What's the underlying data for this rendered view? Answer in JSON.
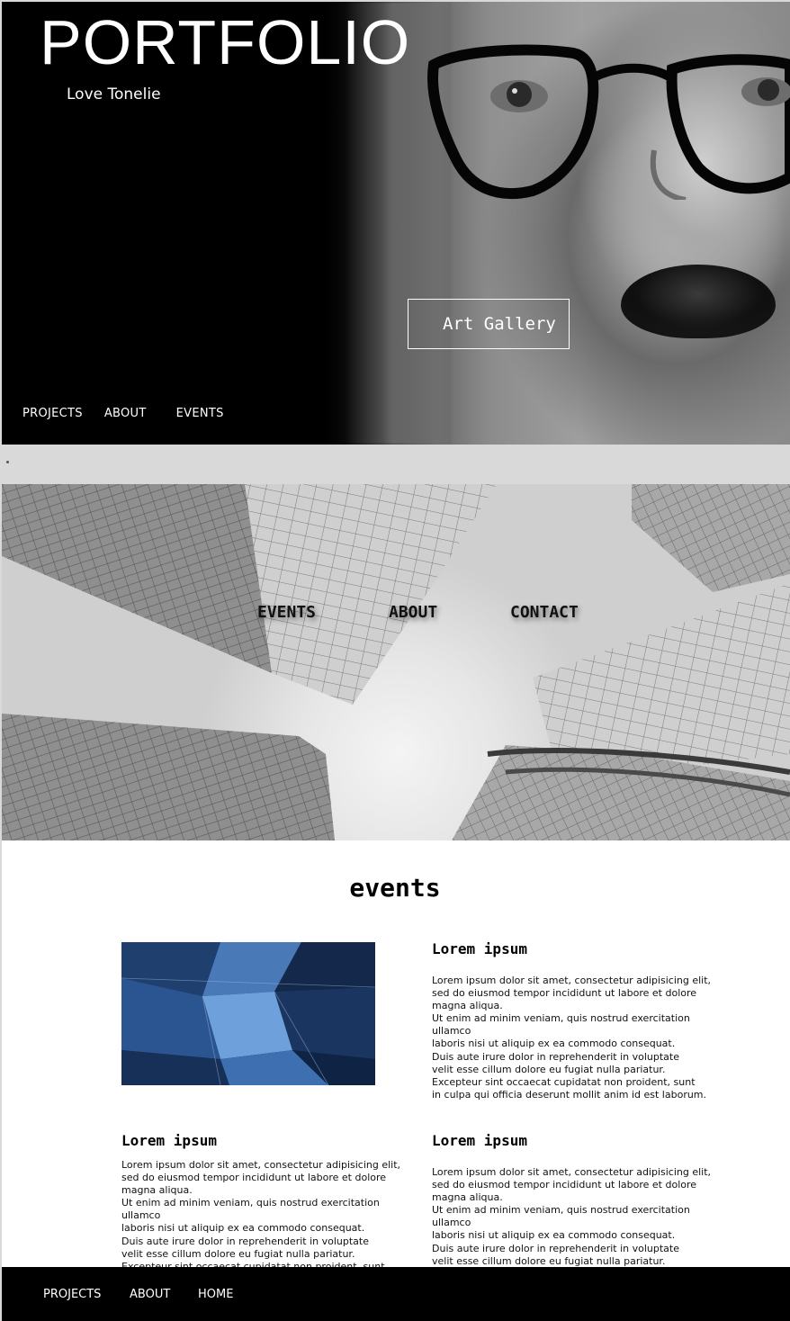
{
  "hero": {
    "title": "PORTFOLIO",
    "subtitle": "Love Tonelie",
    "cta_label": "Art Gallery",
    "nav": [
      "PROJECTS",
      "ABOUT",
      "EVENTS"
    ]
  },
  "city": {
    "nav": [
      "EVENTS",
      "ABOUT",
      "CONTACT"
    ]
  },
  "events": {
    "heading": "events",
    "cards": [
      {
        "title": "Lorem ipsum",
        "body": "Lorem ipsum dolor sit amet, consectetur adipisicing elit,\nsed do eiusmod tempor incididunt ut labore et dolore\nmagna aliqua.\nUt enim ad minim veniam, quis nostrud exercitation ullamco\nlaboris nisi ut aliquip ex ea commodo consequat.\nDuis aute irure dolor in reprehenderit in voluptate\nvelit esse cillum dolore eu fugiat nulla pariatur.\nExcepteur sint occaecat cupidatat non proident, sunt\nin culpa qui officia deserunt mollit anim id est laborum."
      },
      {
        "title": "Lorem ipsum",
        "body": "Lorem ipsum dolor sit amet, consectetur adipisicing elit,\nsed do eiusmod tempor incididunt ut labore et dolore\nmagna aliqua.\nUt enim ad minim veniam, quis nostrud exercitation ullamco\nlaboris nisi ut aliquip ex ea commodo consequat.\nDuis aute irure dolor in reprehenderit in voluptate\nvelit esse cillum dolore eu fugiat nulla pariatur.\nExcepteur sint occaecat cupidatat non proident, sunt\nin culpa qui officia deserunt mollit anim id est laborum."
      },
      {
        "title": "Lorem ipsum",
        "body": "Lorem ipsum dolor sit amet, consectetur adipisicing elit,\nsed do eiusmod tempor incididunt ut labore et dolore\nmagna aliqua.\nUt enim ad minim veniam, quis nostrud exercitation ullamco\nlaboris nisi ut aliquip ex ea commodo consequat.\nDuis aute irure dolor in reprehenderit in voluptate\nvelit esse cillum dolore eu fugiat nulla pariatur.\nExcepteur sint occaecat cupidatat non proident, sunt\nin culpa qui officia deserunt mollit anim id est laborum."
      }
    ]
  },
  "footer": {
    "nav": [
      "PROJECTS",
      "ABOUT",
      "HOME"
    ]
  }
}
